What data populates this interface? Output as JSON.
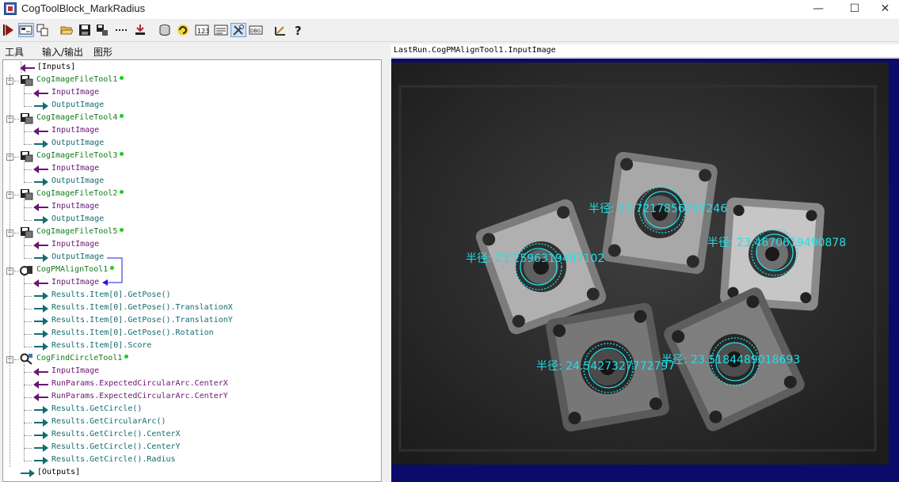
{
  "window": {
    "title": "CogToolBlock_MarkRadius",
    "minimize": "—",
    "maximize": "☐",
    "close": "✕"
  },
  "toolbar": {
    "buttons": [
      "run-icon",
      "tool-view-icon",
      "copy-icon",
      "open-folder-icon",
      "save-icon",
      "floppy-network-icon",
      "dots-icon",
      "import-icon",
      "database-icon",
      "refresh-icon",
      "numeric-icon",
      "form-icon",
      "tools-icon",
      "debug-icon",
      "measure-icon",
      "help-icon"
    ]
  },
  "tabs": {
    "tools": "工具",
    "io": "输入/输出",
    "graphics": "图形"
  },
  "tree": {
    "inputs": "[Inputs]",
    "outputs": "[Outputs]",
    "tools": [
      {
        "name": "CogImageFileTool1",
        "items": [
          {
            "label": "InputImage",
            "dir": "in"
          },
          {
            "label": "OutputImage",
            "dir": "out"
          }
        ]
      },
      {
        "name": "CogImageFileTool4",
        "items": [
          {
            "label": "InputImage",
            "dir": "in"
          },
          {
            "label": "OutputImage",
            "dir": "out"
          }
        ]
      },
      {
        "name": "CogImageFileTool3",
        "items": [
          {
            "label": "InputImage",
            "dir": "in"
          },
          {
            "label": "OutputImage",
            "dir": "out"
          }
        ]
      },
      {
        "name": "CogImageFileTool2",
        "items": [
          {
            "label": "InputImage",
            "dir": "in"
          },
          {
            "label": "OutputImage",
            "dir": "out"
          }
        ]
      },
      {
        "name": "CogImageFileTool5",
        "items": [
          {
            "label": "InputImage",
            "dir": "in"
          },
          {
            "label": "OutputImage",
            "dir": "out"
          }
        ]
      },
      {
        "name": "CogPMAlignTool1",
        "items": [
          {
            "label": "InputImage",
            "dir": "in"
          },
          {
            "label": "Results.Item[0].GetPose()",
            "dir": "out"
          },
          {
            "label": "Results.Item[0].GetPose().TranslationX",
            "dir": "out"
          },
          {
            "label": "Results.Item[0].GetPose().TranslationY",
            "dir": "out"
          },
          {
            "label": "Results.Item[0].GetPose().Rotation",
            "dir": "out"
          },
          {
            "label": "Results.Item[0].Score",
            "dir": "out"
          }
        ]
      },
      {
        "name": "CogFindCircleTool1",
        "items": [
          {
            "label": "InputImage",
            "dir": "in"
          },
          {
            "label": "RunParams.ExpectedCircularArc.CenterX",
            "dir": "in"
          },
          {
            "label": "RunParams.ExpectedCircularArc.CenterY",
            "dir": "in"
          },
          {
            "label": "Results.GetCircle()",
            "dir": "out"
          },
          {
            "label": "Results.GetCircularArc()",
            "dir": "out"
          },
          {
            "label": "Results.GetCircle().CenterX",
            "dir": "out"
          },
          {
            "label": "Results.GetCircle().CenterY",
            "dir": "out"
          },
          {
            "label": "Results.GetCircle().Radius",
            "dir": "out"
          }
        ]
      }
    ]
  },
  "view": {
    "title": "LastRun.CogPMAlignTool1.InputImage",
    "labels": [
      {
        "text": "半径: 23.7217856247246"
      },
      {
        "text": "半径: 23.4670619490878"
      },
      {
        "text": "半径: 23.2596319487102"
      },
      {
        "text": "半径: 24.5427327772797"
      },
      {
        "text": "半径: 23.5184489018693"
      }
    ]
  },
  "colors": {
    "tool": "#157a1e",
    "input_arrow": "#6a1573",
    "output_arrow": "#136b70",
    "overlay": "#1fe0e8",
    "frame": "#0b0b6b"
  }
}
